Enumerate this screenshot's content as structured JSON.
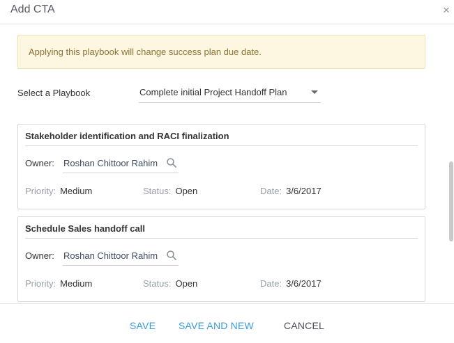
{
  "dialog": {
    "title": "Add CTA",
    "close_label": "×"
  },
  "warning": {
    "text": "Applying this playbook will change success plan due date."
  },
  "playbook": {
    "label": "Select a Playbook",
    "selected": "Complete initial Project Handoff Plan"
  },
  "ctas": [
    {
      "title": "Stakeholder identification and RACI finalization",
      "owner_label": "Owner:",
      "owner": "Roshan Chittoor Rahim",
      "priority_label": "Priority:",
      "priority": "Medium",
      "status_label": "Status:",
      "status": "Open",
      "date_label": "Date:",
      "date": "3/6/2017"
    },
    {
      "title": "Schedule Sales handoff call",
      "owner_label": "Owner:",
      "owner": "Roshan Chittoor Rahim",
      "priority_label": "Priority:",
      "priority": "Medium",
      "status_label": "Status:",
      "status": "Open",
      "date_label": "Date:",
      "date": "3/6/2017"
    }
  ],
  "footer": {
    "save_label": "SAVE",
    "save_new_label": "SAVE AND NEW",
    "cancel_label": "CANCEL"
  },
  "colors": {
    "accent": "#3a9bd9",
    "warning_bg": "#fdf7e1",
    "warning_text": "#8c7335"
  },
  "icons": {
    "close": "close-icon",
    "search": "search-icon",
    "dropdown": "chevron-down-icon"
  }
}
